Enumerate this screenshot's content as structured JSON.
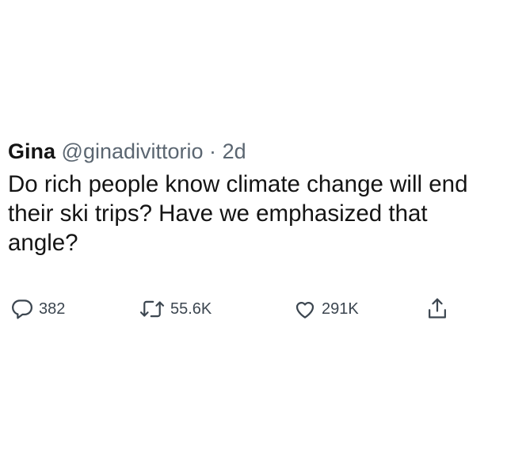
{
  "tweet": {
    "author_name": "Gina",
    "author_handle": "@ginadivittorio",
    "separator": "·",
    "timestamp": "2d",
    "text": "Do rich people know climate change will end their ski trips? Have we emphasized that angle?",
    "actions": {
      "reply": {
        "icon": "reply-icon",
        "count": "382"
      },
      "retweet": {
        "icon": "retweet-icon",
        "count": "55.6K"
      },
      "like": {
        "icon": "heart-icon",
        "count": "291K"
      },
      "share": {
        "icon": "share-icon"
      }
    }
  },
  "colors": {
    "text": "#141414",
    "secondary_text": "#5b6671",
    "icon": "#3c4650",
    "background": "#ffffff"
  }
}
